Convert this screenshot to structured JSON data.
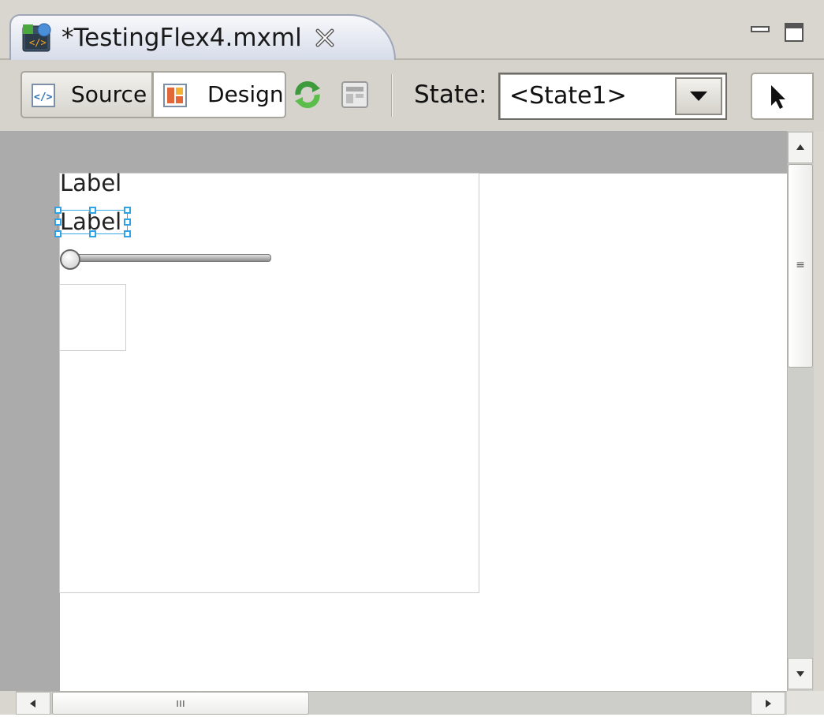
{
  "editor": {
    "tab_title": "*TestingFlex4.mxml",
    "file_icon": "mxml-file-icon",
    "close_icon": "close-tab-icon",
    "window_controls": [
      "minimize-icon",
      "maximize-icon"
    ]
  },
  "toolbar": {
    "source_label": "Source",
    "source_icon": "source-code-icon",
    "design_label": "Design",
    "design_icon": "design-view-icon",
    "active_view": "Design",
    "refresh_icon": "refresh-icon",
    "layout_icon": "layout-icon",
    "state_label": "State:",
    "state_value": "<State1>",
    "state_options": [
      "<State1>"
    ],
    "select_tool_icon": "arrow-pointer-icon"
  },
  "canvas": {
    "label_1": "Label",
    "label_2": "Label",
    "selected_component": "Label",
    "slider_value": 0
  },
  "colors": {
    "canvas_background": "#ababab",
    "artboard": "#ffffff",
    "selection": "#2ea3e8",
    "chrome": "#d6d3cc"
  }
}
